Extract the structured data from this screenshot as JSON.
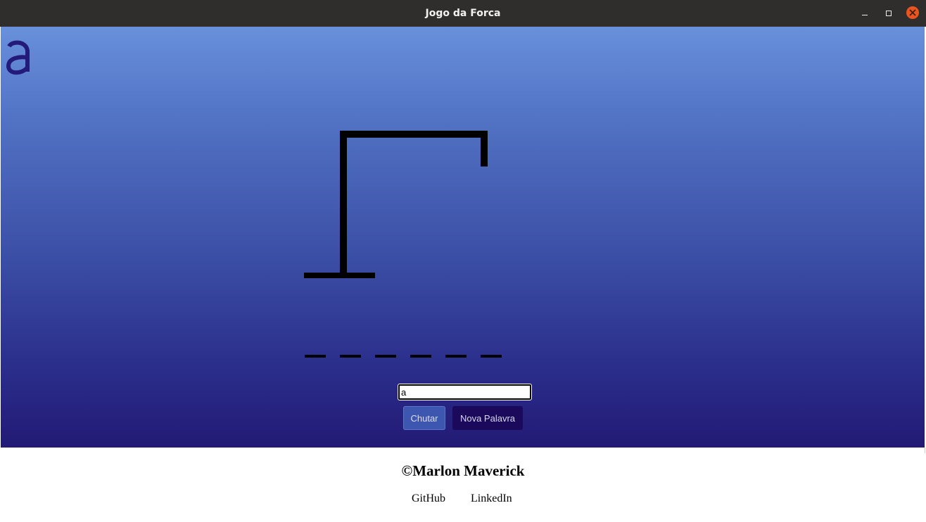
{
  "window": {
    "title": "Jogo da Forca",
    "controls": [
      "minimize-icon",
      "maximize-icon",
      "close-icon"
    ],
    "close_color": "#e95420"
  },
  "game": {
    "logo_glyph": "a",
    "logo_color": "#231a7a",
    "word_slots": 6,
    "guess_input": {
      "value": "a",
      "placeholder": ""
    },
    "buttons": {
      "guess": "Chutar",
      "new_word": "Nova Palavra"
    },
    "colors": {
      "gradient_top": "#6890db",
      "gradient_bottom": "#221a75",
      "guess_button": "#3d57b0",
      "new_word_button": "#1b0a5c"
    }
  },
  "footer": {
    "credit": "©Marlon Maverick",
    "links": [
      "GitHub",
      "LinkedIn"
    ]
  }
}
